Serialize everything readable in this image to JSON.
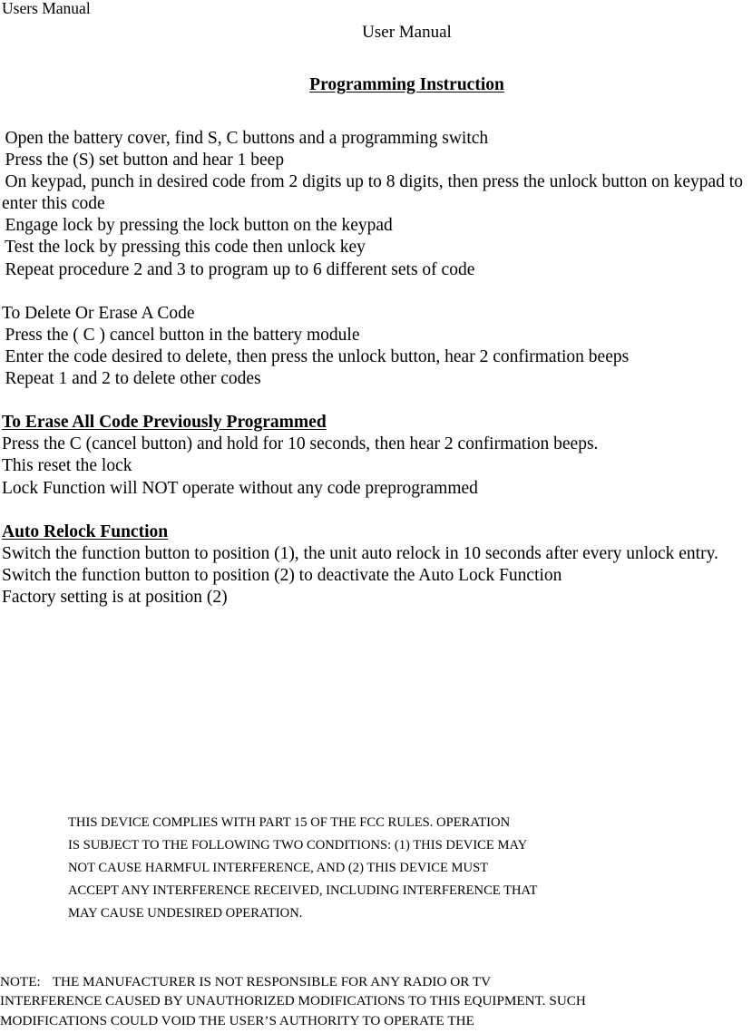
{
  "header": {
    "running_header": "Users Manual",
    "doc_title": "User Manual",
    "section_title": "Programming Instruction"
  },
  "programming_steps": [
    "1. Open the battery cover, find S, C buttons and a programming switch",
    "2. Press the (S) set button and hear 1 beep",
    "3. On keypad, punch in desired code from 2 digits up to 8 digits, then press the unlock button on keypad to enter this code",
    "4. Engage lock by pressing the lock button on the keypad",
    "5. Test the lock by pressing this code then unlock key",
    "6. Repeat procedure 2 and 3 to program up to 6 different sets of code"
  ],
  "delete_section": {
    "heading": "To Delete Or Erase A Code",
    "steps": [
      "1. Press the ( C ) cancel button in the battery module",
      "2. Enter the code desired to delete, then press the unlock button, hear 2 confirmation beeps",
      "3. Repeat 1 and 2 to delete other codes"
    ]
  },
  "erase_all_section": {
    "heading": "To Erase All Code Previously Programmed",
    "lines": [
      "Press the C (cancel button) and hold for 10 seconds, then hear 2 confirmation beeps.",
      "This reset the lock",
      "Lock Function will NOT operate without any code preprogrammed"
    ]
  },
  "auto_relock_section": {
    "heading": "Auto Relock Function",
    "lines": [
      "Switch the function button to position (1), the unit auto relock in 10 seconds after every unlock entry.",
      "Switch the function button to position (2) to deactivate the Auto Lock Function",
      "Factory setting is at position (2)"
    ]
  },
  "fcc_statement": {
    "lines": [
      "THIS DEVICE COMPLIES WITH PART 15 OF THE FCC RULES. OPERATION",
      "IS SUBJECT TO THE FOLLOWING TWO CONDITIONS: (1) THIS DEVICE MAY",
      "NOT CAUSE HARMFUL INTERFERENCE, AND (2) THIS DEVICE MUST",
      "ACCEPT ANY INTERFERENCE RECEIVED, INCLUDING INTERFERENCE THAT",
      "MAY CAUSE UNDESIRED OPERATION."
    ]
  },
  "note_statement": {
    "label": "NOTE:",
    "lines": [
      "THE MANUFACTURER IS NOT RESPONSIBLE FOR ANY RADIO OR TV",
      "INTERFERENCE CAUSED BY UNAUTHORIZED MODIFICATIONS TO THIS EQUIPMENT. SUCH",
      "MODIFICATIONS COULD VOID THE USER’S AUTHORITY TO OPERATE THE"
    ]
  }
}
